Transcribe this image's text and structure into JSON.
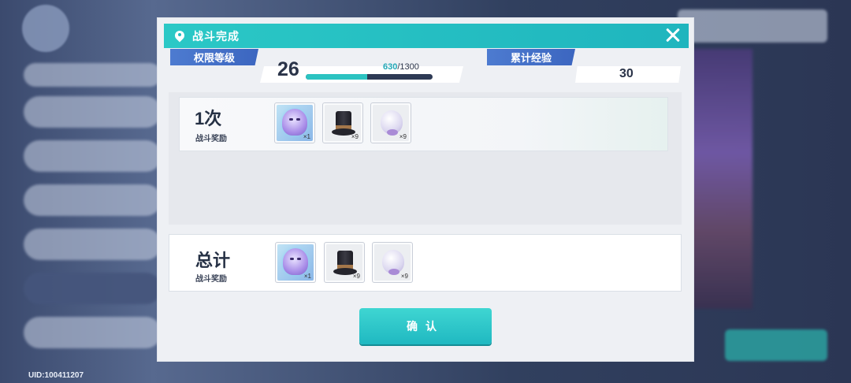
{
  "background": {
    "uid_text": "UID:100411207"
  },
  "dialog": {
    "title": "战斗完成",
    "title_icon": "location-pin-icon",
    "close_icon": "close-icon",
    "colors": {
      "title_bar": "#22bcc0",
      "label_tag": "#4470c6",
      "confirm": "#2cc6c8"
    }
  },
  "stats": {
    "level_label": "权限等级",
    "level_value": "26",
    "exp_current": "630",
    "exp_max": "/1300",
    "exp_fraction": 0.4846,
    "total_exp_label": "累计经验",
    "total_exp_value": "30"
  },
  "battle_reward": {
    "count_label": "1次",
    "sub_label": "战斗奖励",
    "items": [
      {
        "icon": "purple-ghost-icon",
        "qty": "×1"
      },
      {
        "icon": "top-hat-icon",
        "qty": "×9"
      },
      {
        "icon": "white-ghost-icon",
        "qty": "×9"
      }
    ]
  },
  "total_reward": {
    "count_label": "总计",
    "sub_label": "战斗奖励",
    "items": [
      {
        "icon": "purple-ghost-icon",
        "qty": "×1"
      },
      {
        "icon": "top-hat-icon",
        "qty": "×9"
      },
      {
        "icon": "white-ghost-icon",
        "qty": "×9"
      }
    ]
  },
  "confirm_label": "确认"
}
